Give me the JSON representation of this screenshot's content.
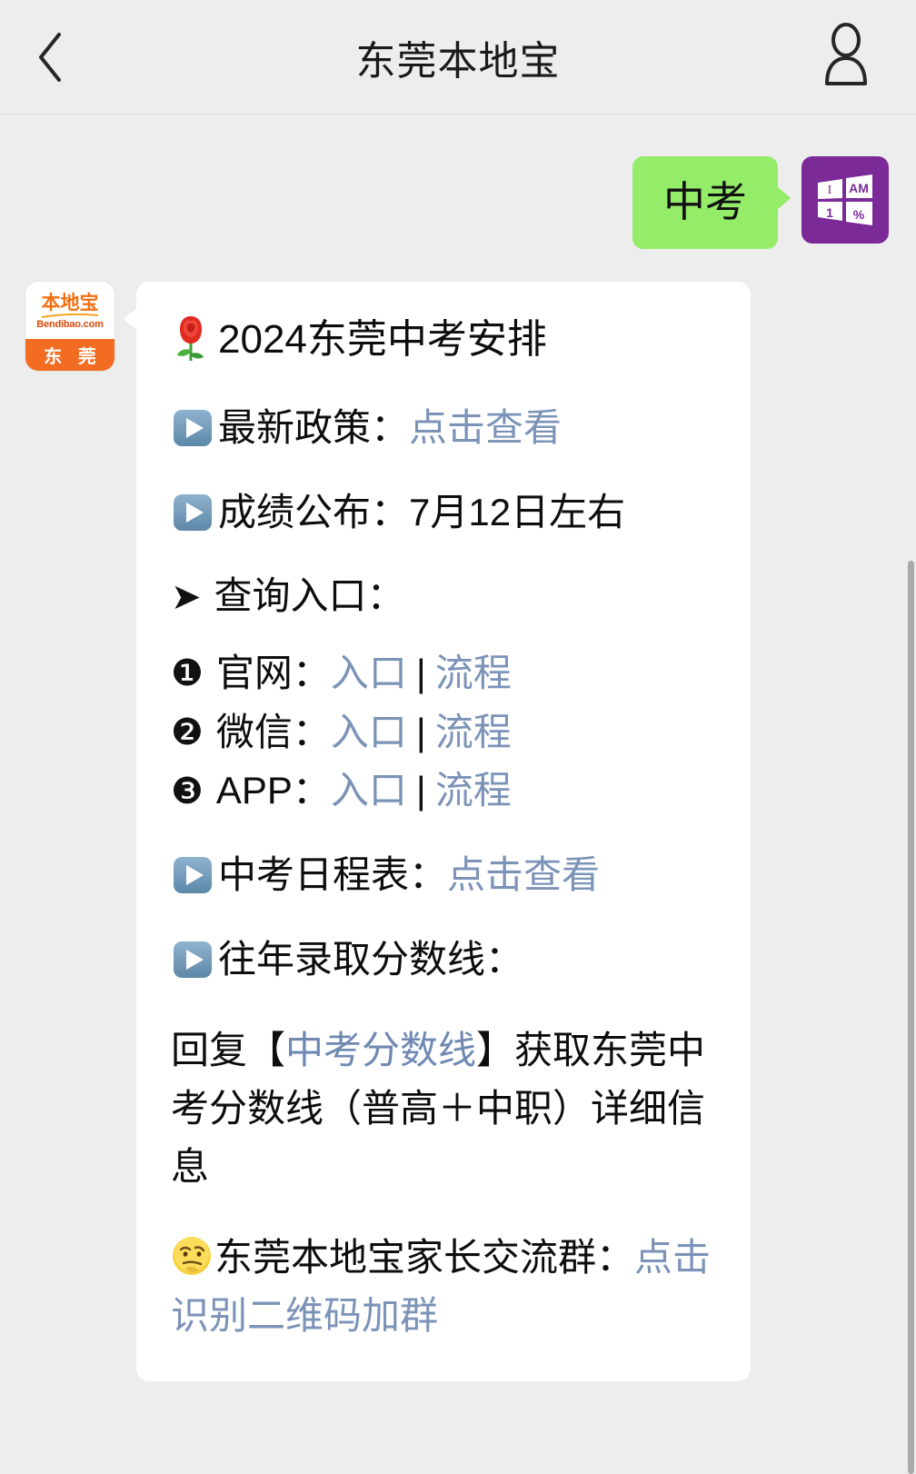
{
  "header": {
    "back_icon": "chevron-left-icon",
    "title": "东莞本地宝",
    "contact_icon": "contact-person-icon"
  },
  "chat": {
    "outgoing": {
      "text": "中考",
      "bubble_color": "#95ec69",
      "avatar": {
        "icon": "windows-logo-avatar",
        "background": "#7b2a97",
        "panes": [
          "I",
          "AM",
          "1",
          "%"
        ]
      }
    },
    "incoming": {
      "avatar": {
        "brand_cn": "本地宝",
        "brand_en": "Bendibao.com",
        "city": "东 莞",
        "top_color": "#ffffff",
        "bottom_color": "#f26d21",
        "text_color": "#f07010"
      },
      "bubble_color": "#ffffff",
      "link_color": "#7c93b8",
      "title": {
        "emoji": "rose-emoji",
        "text": "2024东莞中考安排"
      },
      "lines": [
        {
          "emoji": "play-button-emoji",
          "label": "最新政策：",
          "link": "点击查看"
        },
        {
          "emoji": "play-button-emoji",
          "label": "成绩公布：",
          "value": "7月12日左右"
        },
        {
          "marker": "➤",
          "label": "查询入口："
        }
      ],
      "entries": [
        {
          "marker": "❶",
          "label": "官网：",
          "link1": "入口",
          "sep": "|",
          "link2": "流程"
        },
        {
          "marker": "❷",
          "label": "微信：",
          "link1": "入口",
          "sep": "|",
          "link2": "流程"
        },
        {
          "marker": "❸",
          "label": "APP：",
          "link1": "入口",
          "sep": "|",
          "link2": "流程"
        }
      ],
      "schedule_line": {
        "emoji": "play-button-emoji",
        "label": "中考日程表：",
        "link": "点击查看"
      },
      "score_line": {
        "emoji": "play-button-emoji",
        "label": "往年录取分数线："
      },
      "reply_paragraph": {
        "prefix": "回复【",
        "keyword": "中考分数线",
        "suffix": "】获取东莞中考分数线（普高＋中职）详细信息"
      },
      "group_paragraph": {
        "emoji": "thinking-face-emoji",
        "label": "东莞本地宝家长交流群：",
        "link": "点击识别二维码加群"
      }
    }
  },
  "scrollbar": {
    "name": "vertical-scrollbar",
    "color": "#aaaaaa"
  }
}
